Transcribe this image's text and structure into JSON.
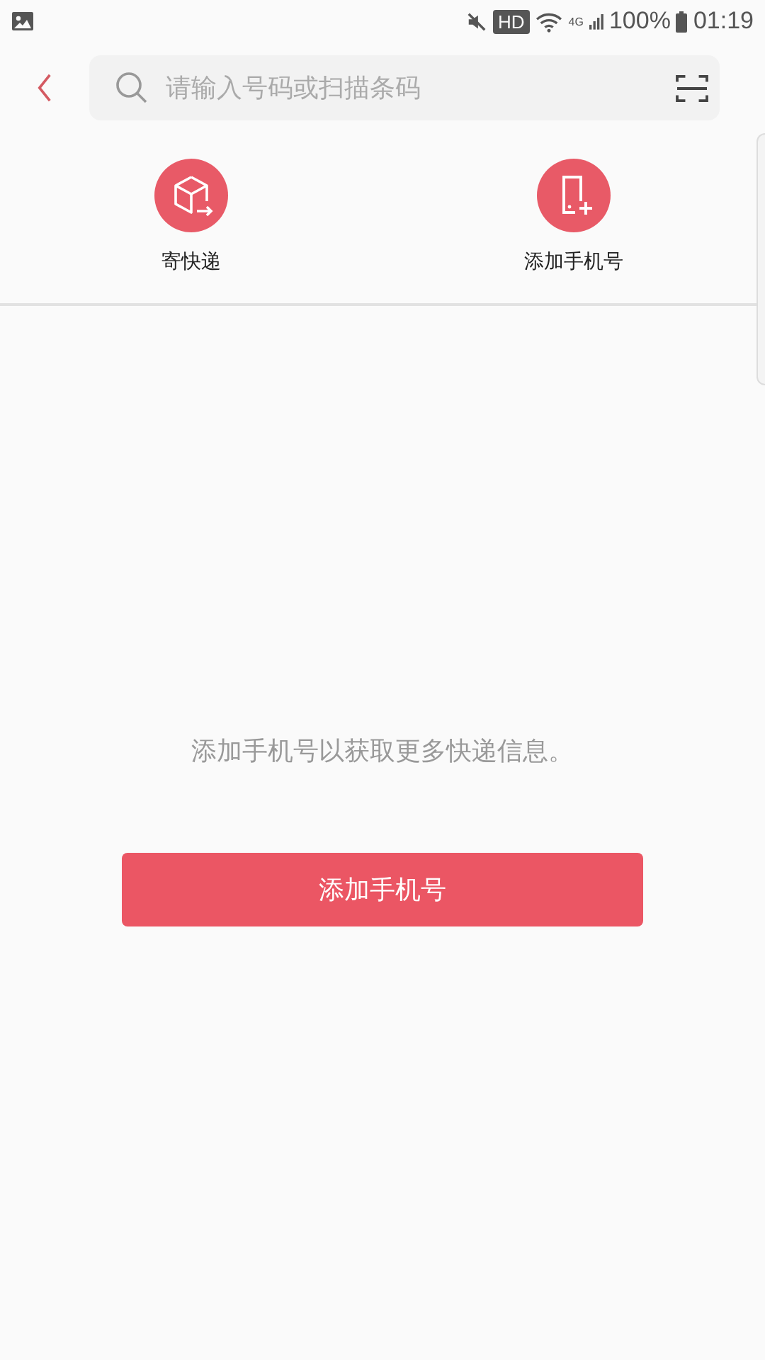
{
  "status_bar": {
    "hd_badge": "HD",
    "network": "4G",
    "battery": "100%",
    "time": "01:19"
  },
  "search": {
    "placeholder": "请输入号码或扫描条码"
  },
  "actions": [
    {
      "kind": "send",
      "label": "寄快递"
    },
    {
      "kind": "add-phone",
      "label": "添加手机号"
    }
  ],
  "empty_message": "添加手机号以获取更多快递信息。",
  "primary_button": "添加手机号"
}
